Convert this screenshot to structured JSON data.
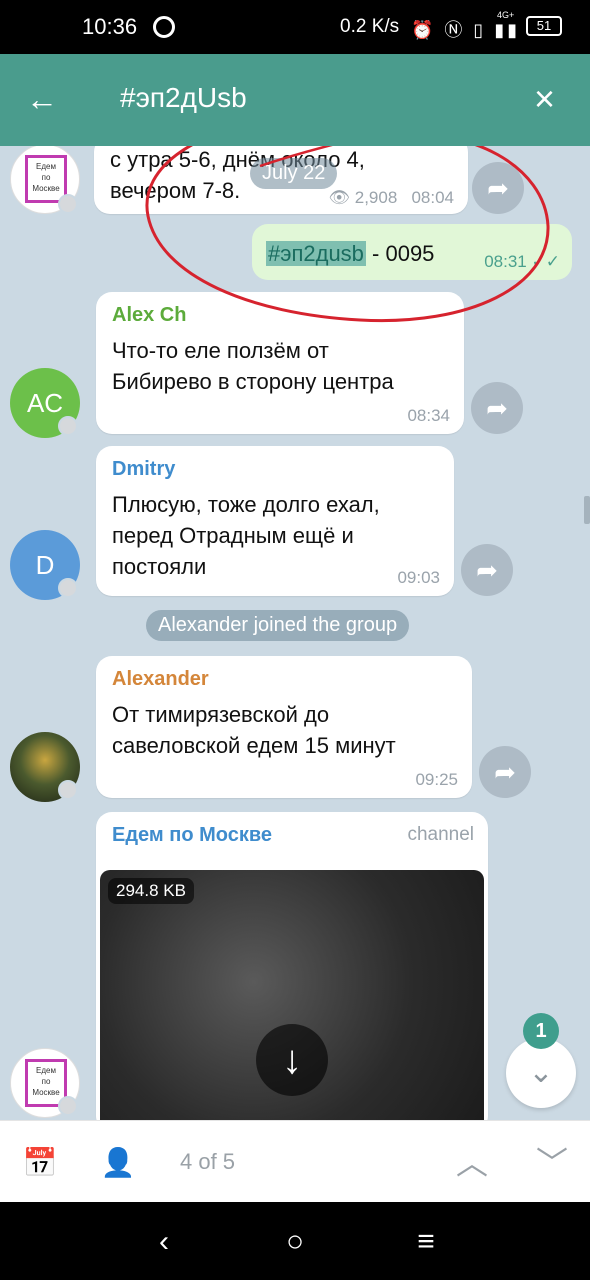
{
  "status_bar": {
    "time": "10:36",
    "net_speed": "0.2 K/s",
    "icons": "⏰ Ⓝ ▯ ▮▮",
    "network": "4G+",
    "battery": "51"
  },
  "header": {
    "search_query": "#эп2дUsb"
  },
  "messages": [
    {
      "kind": "channel_post",
      "text_line1": "с утра  5-6, днём около 4,",
      "text_line2": "вечером 7-8.",
      "date_overlay": "July 22",
      "views": "2,908",
      "time": "08:04"
    },
    {
      "kind": "outgoing",
      "hashtag": "#эп2дusb",
      "suffix": " - 0095",
      "time": "08:31"
    },
    {
      "kind": "incoming",
      "avatar_initials": "AC",
      "avatar_color": "#6cc04a",
      "sender": "Alex Ch",
      "sender_color": "#5cab3b",
      "text_line1": "Что-то еле ползём от",
      "text_line2": "Бибирево в сторону центра",
      "time": "08:34"
    },
    {
      "kind": "incoming",
      "avatar_initials": "D",
      "avatar_color": "#5b9bd9",
      "sender": "Dmitry",
      "sender_color": "#3f8ccd",
      "text_line1": "Плюсую, тоже долго ехал,",
      "text_line2": "перед Отрадным ещё и",
      "text_line3": "постояли",
      "time": "09:03"
    },
    {
      "kind": "service",
      "text": "Alexander joined the group"
    },
    {
      "kind": "incoming",
      "sender": "Alexander",
      "sender_color": "#d4863a",
      "text_line1": "От тимирязевской до",
      "text_line2": "савеловской едем 15 минут",
      "time": "09:25"
    },
    {
      "kind": "channel_media",
      "sender": "Едем по Москве",
      "sender_color": "#3f8ccd",
      "label": "channel",
      "file_size": "294.8 KB"
    }
  ],
  "channel_logo": {
    "line1": "Едем",
    "line2": "по",
    "line3": "Москве"
  },
  "fab": {
    "badge": "1"
  },
  "toolbar": {
    "counter": "4 of 5"
  }
}
